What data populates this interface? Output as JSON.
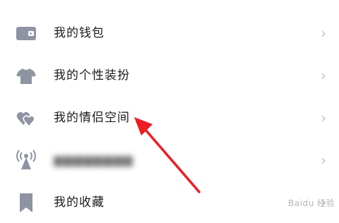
{
  "menu": {
    "items": [
      {
        "label": "我的钱包",
        "icon": "wallet-icon"
      },
      {
        "label": "我的个性装扮",
        "icon": "tshirt-icon"
      },
      {
        "label": "我的情侣空间",
        "icon": "hearts-icon"
      },
      {
        "label": "",
        "icon": "broadcast-antenna-icon",
        "note": ""
      },
      {
        "label": "我的收藏",
        "icon": "bookmark-icon"
      }
    ],
    "chevron": "›"
  },
  "colors": {
    "icon": "#8f94a3",
    "arrow": "#ee1d23",
    "text": "#1b1b1b",
    "chevron": "#c4c4c4"
  },
  "watermark": "Baidu 经验"
}
